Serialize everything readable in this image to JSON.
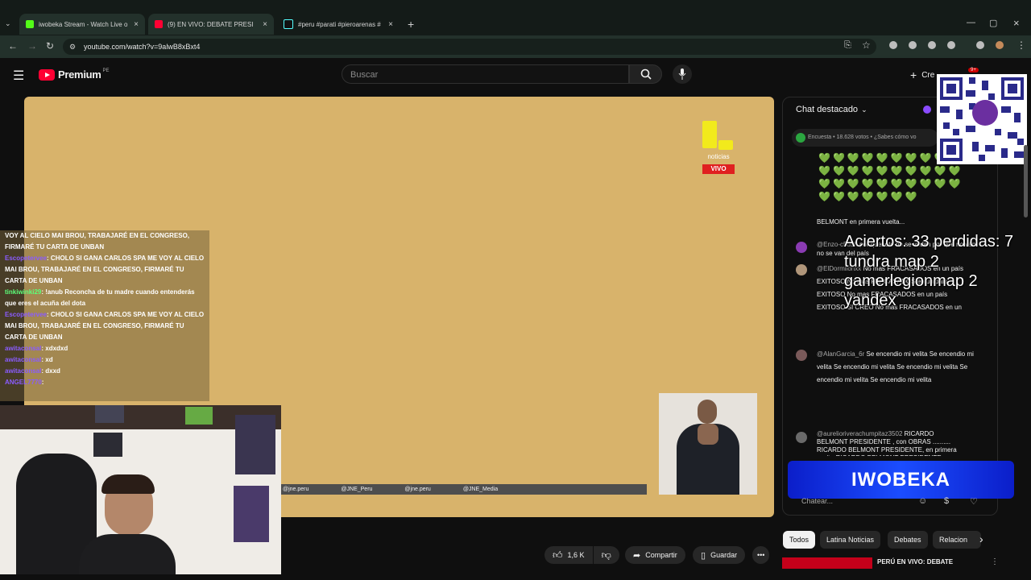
{
  "browser": {
    "tabs": [
      {
        "title": "iwobeka Stream - Watch Live o"
      },
      {
        "title": "(9) EN VIVO: DEBATE PRESI"
      },
      {
        "title": "#peru #parati #pieroarenas #"
      }
    ],
    "url": "youtube.com/watch?v=9alwB8xBxt4"
  },
  "youtube": {
    "brand": "Premium",
    "region": "PE",
    "search_placeholder": "Buscar",
    "create_label": "Cre",
    "notif_count": "9+"
  },
  "video": {
    "channel_logo_text": "noticias",
    "live_label": "VIVO",
    "ticker": [
      "@jne.peru",
      "@JNE_Peru",
      "@jne.peru",
      "@JNE_Media"
    ]
  },
  "twitch_chat": [
    {
      "user": "",
      "text": "VOY AL CIELO MAI BROU, TRABAJARÉ EN EL CONGRESO, FIRMARÉ TU CARTA DE UNBAN"
    },
    {
      "user": "Escopetervee",
      "text": ": CHOLO SI GANA CARLOS SPA ME VOY AL CIELO MAI BROU, TRABAJARÉ EN EL CONGRESO, FIRMARÉ TU CARTA DE UNBAN"
    },
    {
      "user": "tinkiwinki29",
      "text": ": !anub Reconcha de tu madre cuando entenderás que eres el acuña del dota"
    },
    {
      "user": "Escopetervee",
      "text": ": CHOLO SI GANA CARLOS SPA ME VOY AL CIELO MAI BROU, TRABAJARÉ EN EL CONGRESO, FIRMARÉ TU CARTA DE UNBAN"
    },
    {
      "user": "awitaconsal",
      "text": ": xdxdxd"
    },
    {
      "user": "awitaconsal",
      "text": ": xd"
    },
    {
      "user": "awitaconsal",
      "text": ": dxxd"
    },
    {
      "user": "ANGEL7770",
      "text": ":"
    }
  ],
  "actions": {
    "likes": "1,6 K",
    "share": "Compartir",
    "save": "Guardar"
  },
  "chat": {
    "header": "Chat destacado",
    "poll": "Encuesta • 18.628 votos • ¿Sabes cómo vo",
    "messages": [
      {
        "author": "",
        "text": "BELMONT en primera vuelta..."
      },
      {
        "author": "@Enzo-c5u5h",
        "text": "por quenote no se vadan por que no van no se van del país"
      },
      {
        "author": "@ElDormilonxx",
        "text": "No mas FRACASADOS en un país EXITOSO No mas FRACASADOS en un país EXITOSO No mas FRACASADOS en un país EXITOSO SI CREO No mas FRACASADOS en un"
      },
      {
        "author": "@AlanGarcia_6r",
        "text": "Se encendio mi velita Se encendio mi velita Se encendio mi velita Se encendio mi velita Se encendio mi velita Se encendio mi velita"
      },
      {
        "author": "@aurelioriverachumpitaz3502",
        "text": "RICARDO BELMONT PRESIDENTE , con OBRAS .......... RICARDO BELMONT PRESIDENTE, en primera vuelta RICARDO BELMONT PRESIDENTE con"
      }
    ],
    "input_placeholder": "Chatear..."
  },
  "overlay": {
    "line1": "Aciertos: 33 perdidas: 7",
    "line2": "tundra map 2",
    "line3": "gamerlegionmap 2",
    "line4": "yandex",
    "banner": "IWOBEKA"
  },
  "chips": [
    "Todos",
    "Latina Noticias",
    "Debates",
    "Relacion"
  ],
  "related": {
    "title": "PERÚ EN VIVO: DEBATE"
  }
}
